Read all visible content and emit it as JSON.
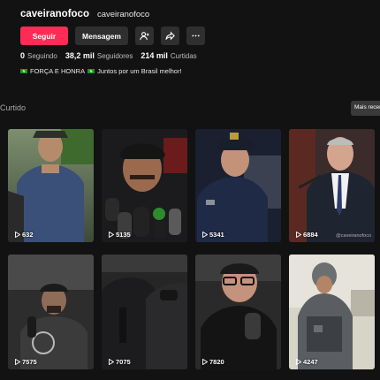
{
  "profile": {
    "display_name": "caveiranofoco",
    "username": "caveiranofoco",
    "follow_label": "Seguir",
    "message_label": "Mensagem",
    "stats": [
      {
        "num": "0",
        "label": "Seguindo"
      },
      {
        "num": "38,2 mil",
        "label": "Seguidores"
      },
      {
        "num": "214 mil",
        "label": "Curtidas"
      }
    ],
    "bio": {
      "part1": "FORÇA E HONRA",
      "part2": "Juntos por um Brasil melhor!"
    },
    "icons": [
      "add-friend-icon",
      "share-icon",
      "more-icon"
    ]
  },
  "section": {
    "title": "Curtido",
    "recent_label": "Mais recentes"
  },
  "videos": [
    {
      "views": "632",
      "theme": "outdoor-man-cap"
    },
    {
      "views": "5135",
      "theme": "night-interview-microphones"
    },
    {
      "views": "5341",
      "theme": "police-officer-car"
    },
    {
      "views": "6884",
      "theme": "man-suit-speech",
      "watermark": "@caveiranofoco"
    },
    {
      "views": "7575",
      "theme": "man-cap-podcast"
    },
    {
      "views": "7075",
      "theme": "police-officers-dark"
    },
    {
      "views": "7820",
      "theme": "man-glasses-podcast"
    },
    {
      "views": "4247",
      "theme": "soldier-camouflage-helmet"
    }
  ],
  "colors": {
    "background": "#121212",
    "follow_button": "#fe2c55",
    "secondary_button": "#2f2f2f"
  }
}
